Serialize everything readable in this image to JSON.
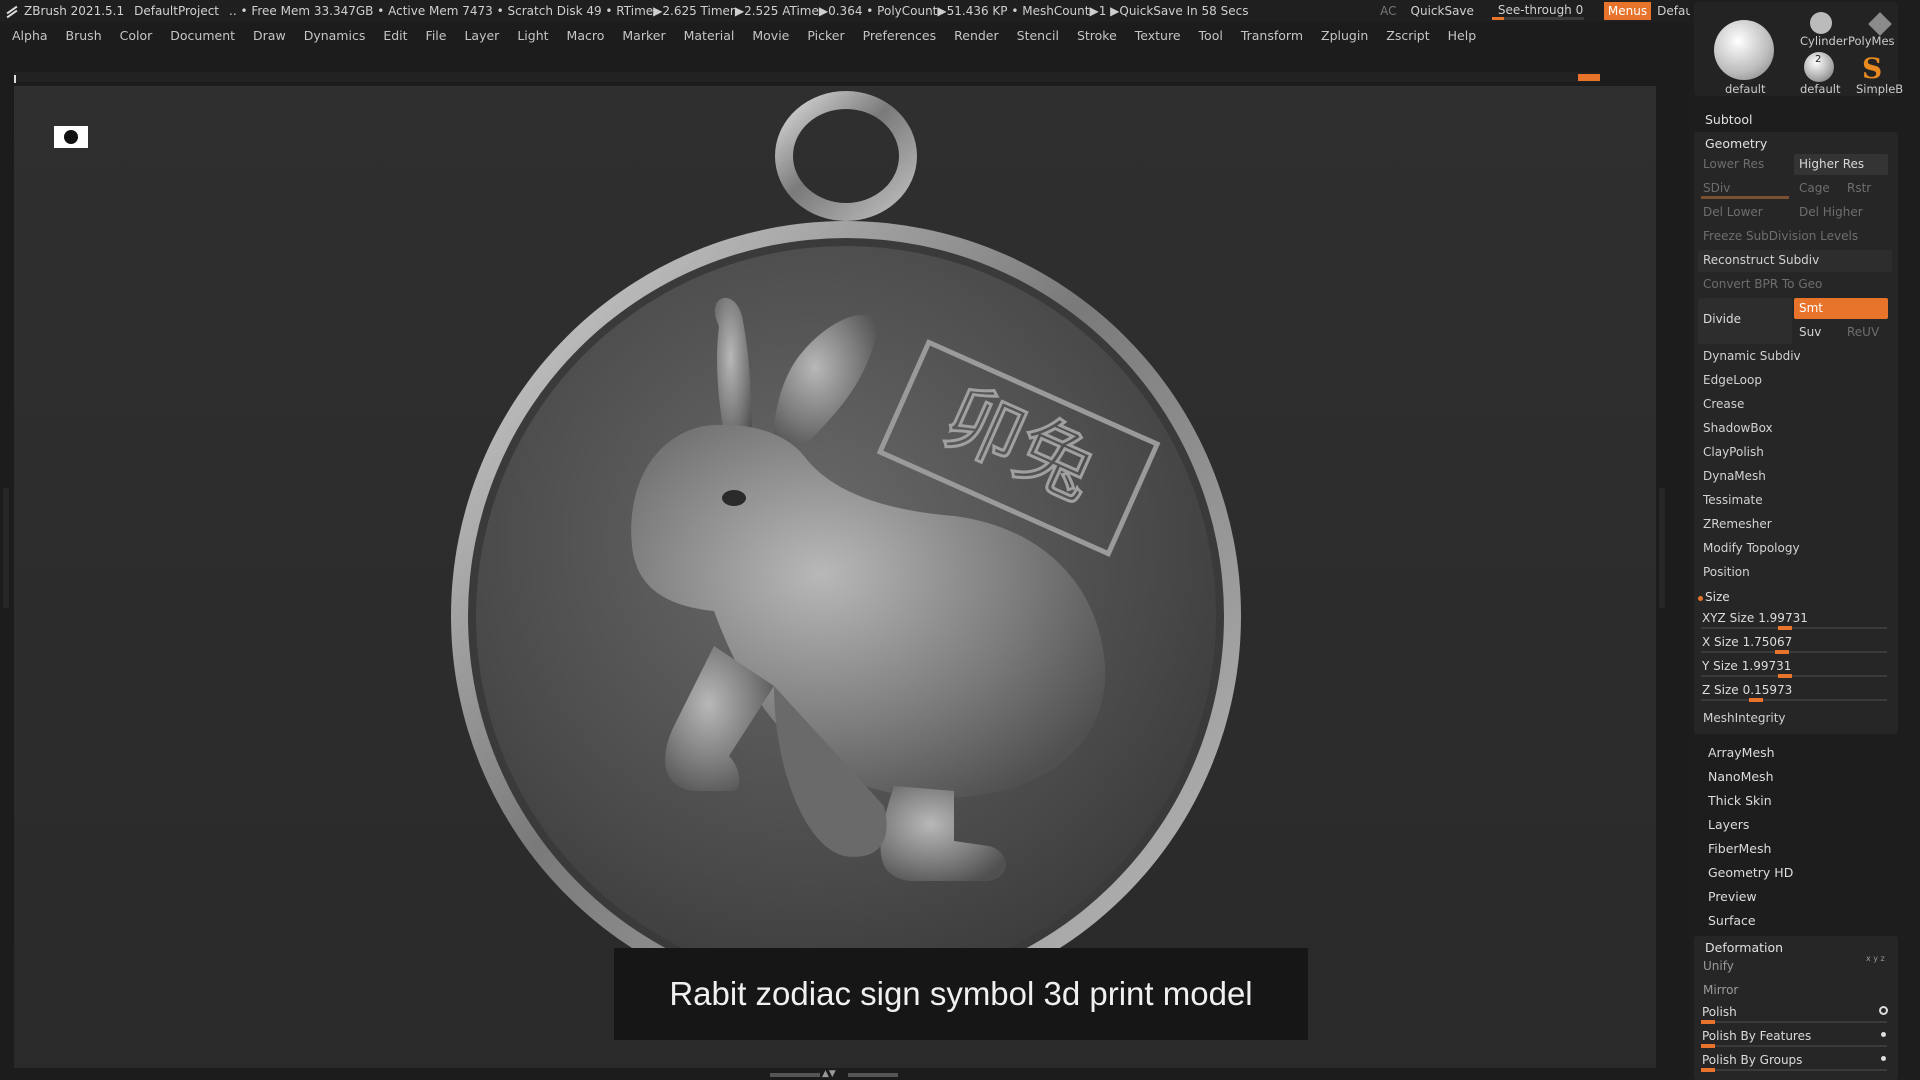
{
  "titlebar": {
    "app": "ZBrush 2021.5.1",
    "project": "DefaultProject",
    "status": ".. • Free Mem 33.347GB • Active Mem 7473 • Scratch Disk 49 •  RTime▶2.625 Timer▶2.525 ATime▶0.364 • PolyCount▶51.436 KP  • MeshCount▶1  ▶QuickSave In 58 Secs",
    "ac": "AC",
    "quicksave": "QuickSave",
    "see_through": "See-through  0",
    "see_through_value": 0,
    "menus": "Menus",
    "script": "DefaultZScript"
  },
  "menubar": [
    "Alpha",
    "Brush",
    "Color",
    "Document",
    "Draw",
    "Dynamics",
    "Edit",
    "File",
    "Layer",
    "Light",
    "Macro",
    "Marker",
    "Material",
    "Movie",
    "Picker",
    "Preferences",
    "Render",
    "Stencil",
    "Stroke",
    "Texture",
    "Tool",
    "Transform",
    "Zplugin",
    "Zscript",
    "Help"
  ],
  "viewport": {
    "caption": "Rabit zodiac sign symbol 3d print model",
    "medal_text": "卯兔"
  },
  "thumbs": {
    "default1": "default",
    "cylinder": "Cylinder",
    "polymesh": "PolyMes",
    "default2": "default",
    "simpleb": "SimpleB",
    "count": "2"
  },
  "panel": {
    "subtool": "Subtool",
    "geometry": {
      "title": "Geometry",
      "lower_res": "Lower Res",
      "higher_res": "Higher Res",
      "sdiv": "SDiv",
      "cage": "Cage",
      "rstr": "Rstr",
      "del_lower": "Del Lower",
      "del_higher": "Del Higher",
      "freeze": "Freeze SubDivision Levels",
      "reconstruct": "Reconstruct Subdiv",
      "convert": "Convert BPR To Geo",
      "divide": "Divide",
      "smt": "Smt",
      "suv": "Suv",
      "reuv": "ReUV",
      "items": [
        "Dynamic Subdiv",
        "EdgeLoop",
        "Crease",
        "ShadowBox",
        "ClayPolish",
        "DynaMesh",
        "Tessimate",
        "ZRemesher",
        "Modify Topology",
        "Position"
      ],
      "size": "Size",
      "sliders": [
        {
          "label": "XYZ Size",
          "value": "1.99731",
          "fraction": 0.45
        },
        {
          "label": "X Size",
          "value": "1.75067",
          "fraction": 0.43
        },
        {
          "label": "Y Size",
          "value": "1.99731",
          "fraction": 0.45
        },
        {
          "label": "Z Size",
          "value": "0.15973",
          "fraction": 0.28
        }
      ],
      "mesh_integrity": "MeshIntegrity"
    },
    "list": [
      "ArrayMesh",
      "NanoMesh",
      "Thick Skin",
      "Layers",
      "FiberMesh",
      "Geometry HD",
      "Preview",
      "Surface"
    ],
    "deformation": {
      "title": "Deformation",
      "unify": "Unify",
      "mirror": "Mirror",
      "polish": "Polish",
      "polish_features": "Polish By Features",
      "polish_groups": "Polish By Groups",
      "axes": "x y z"
    }
  }
}
